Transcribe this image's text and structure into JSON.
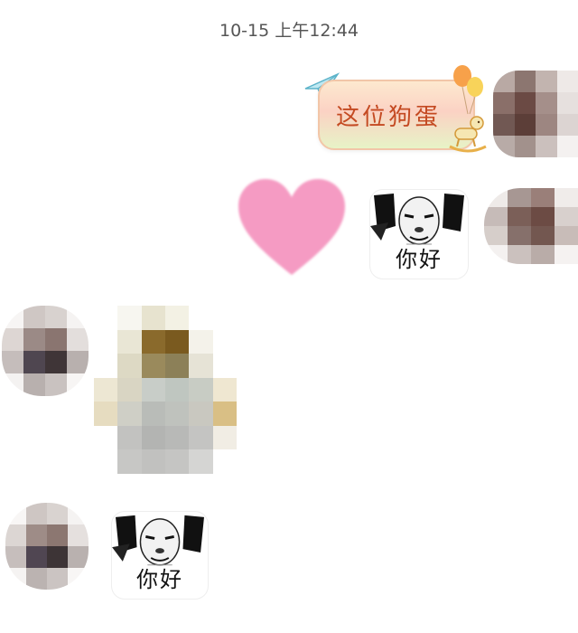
{
  "chat": {
    "timestamp": "10-15 上午12:44",
    "messages": [
      {
        "side": "right",
        "type": "sticker-text",
        "text": "这位狗蛋",
        "decorations": [
          "paper-plane-icon",
          "balloon-icon",
          "rocking-horse-icon"
        ]
      },
      {
        "side": "right",
        "type": "sticker",
        "icon": "pink-heart-icon"
      },
      {
        "side": "right",
        "type": "meme",
        "caption": "你好"
      },
      {
        "side": "left",
        "type": "image",
        "note": "pixelated"
      },
      {
        "side": "left",
        "type": "meme",
        "caption": "你好"
      }
    ]
  },
  "colors": {
    "background": "#ffffff",
    "timestamp": "#555555",
    "bubble_text": "#c44a22",
    "heart": "#f49ac1"
  }
}
